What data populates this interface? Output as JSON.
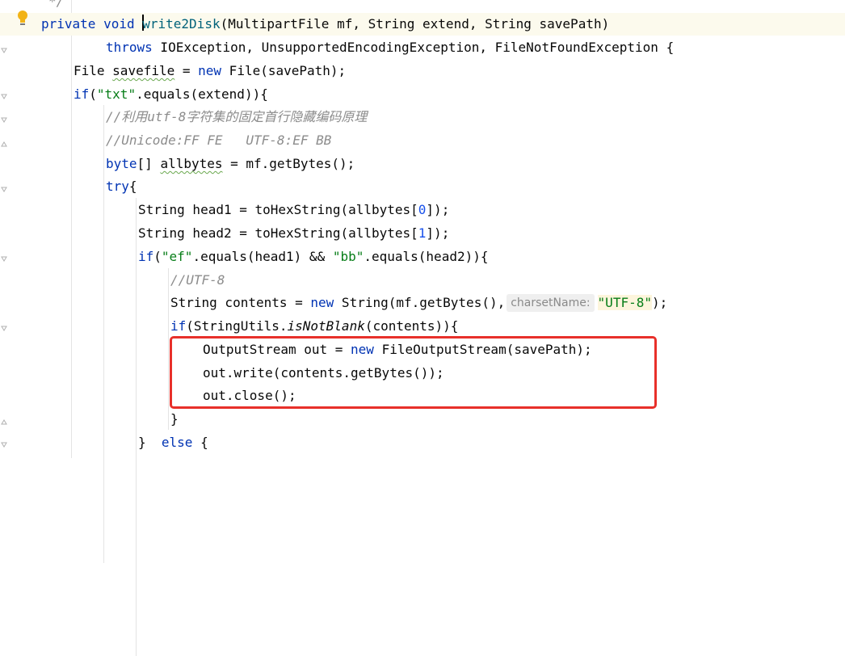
{
  "editor": {
    "lines": [
      [
        {
          "t": "*/",
          "c": "cmt"
        }
      ],
      [
        {
          "t": "private",
          "c": "kw"
        },
        {
          "t": " "
        },
        {
          "t": "void",
          "c": "kw"
        },
        {
          "t": " "
        },
        {
          "t": "write2Disk",
          "c": "fn",
          "caret": true
        },
        {
          "t": "(MultipartFile mf, String extend, String savePath)"
        }
      ],
      [
        {
          "t": "throws",
          "c": "kw"
        },
        {
          "t": " IOException, UnsupportedEncodingException, FileNotFoundException {"
        }
      ],
      [
        {
          "t": "File "
        },
        {
          "t": "savefile",
          "c": "squiggle"
        },
        {
          "t": " = "
        },
        {
          "t": "new",
          "c": "kw"
        },
        {
          "t": " File(savePath);"
        }
      ],
      [
        {
          "t": "if",
          "c": "kw"
        },
        {
          "t": "("
        },
        {
          "t": "\"txt\"",
          "c": "str"
        },
        {
          "t": ".equals(extend)){"
        }
      ],
      [
        {
          "t": "//利用utf-8字符集的固定首行隐藏编码原理",
          "c": "cmt"
        }
      ],
      [
        {
          "t": "//Unicode:FF FE   UTF-8:EF BB",
          "c": "cmt"
        }
      ],
      [
        {
          "t": "byte",
          "c": "kw"
        },
        {
          "t": "[] "
        },
        {
          "t": "allbytes",
          "c": "squiggle"
        },
        {
          "t": " = mf.getBytes();"
        }
      ],
      [
        {
          "t": "try",
          "c": "kw"
        },
        {
          "t": "{"
        }
      ],
      [
        {
          "t": "String head1 = toHexString(allbytes["
        },
        {
          "t": "0",
          "c": "num"
        },
        {
          "t": "]);"
        }
      ],
      [
        {
          "t": "String head2 = toHexString(allbytes["
        },
        {
          "t": "1",
          "c": "num"
        },
        {
          "t": "]);"
        }
      ],
      [
        {
          "t": "if",
          "c": "kw"
        },
        {
          "t": "("
        },
        {
          "t": "\"ef\"",
          "c": "str"
        },
        {
          "t": ".equals(head1) && "
        },
        {
          "t": "\"bb\"",
          "c": "str"
        },
        {
          "t": ".equals(head2)){"
        }
      ],
      [
        {
          "t": "//UTF-8",
          "c": "cmt"
        }
      ],
      [
        {
          "t": "String contents = "
        },
        {
          "t": "new",
          "c": "kw"
        },
        {
          "t": " String(mf.getBytes(),"
        },
        {
          "t": "charsetName:",
          "c": "hint"
        },
        {
          "t": "\"UTF-8\"",
          "c": "str str-box"
        },
        {
          "t": ");"
        }
      ],
      [
        {
          "t": "if",
          "c": "kw"
        },
        {
          "t": "(StringUtils."
        },
        {
          "t": "isNotBlank",
          "c": "ital"
        },
        {
          "t": "(contents)){"
        }
      ],
      [
        {
          "t": "OutputStream out = "
        },
        {
          "t": "new",
          "c": "kw"
        },
        {
          "t": " FileOutputStream(savePath);"
        }
      ],
      [
        {
          "t": "out.write(contents.getBytes());"
        }
      ],
      [
        {
          "t": "out.close();"
        }
      ],
      [
        {
          "t": "}"
        }
      ],
      [
        {
          "t": "}  "
        },
        {
          "t": "else",
          "c": "kw"
        },
        {
          "t": " {"
        }
      ]
    ]
  }
}
